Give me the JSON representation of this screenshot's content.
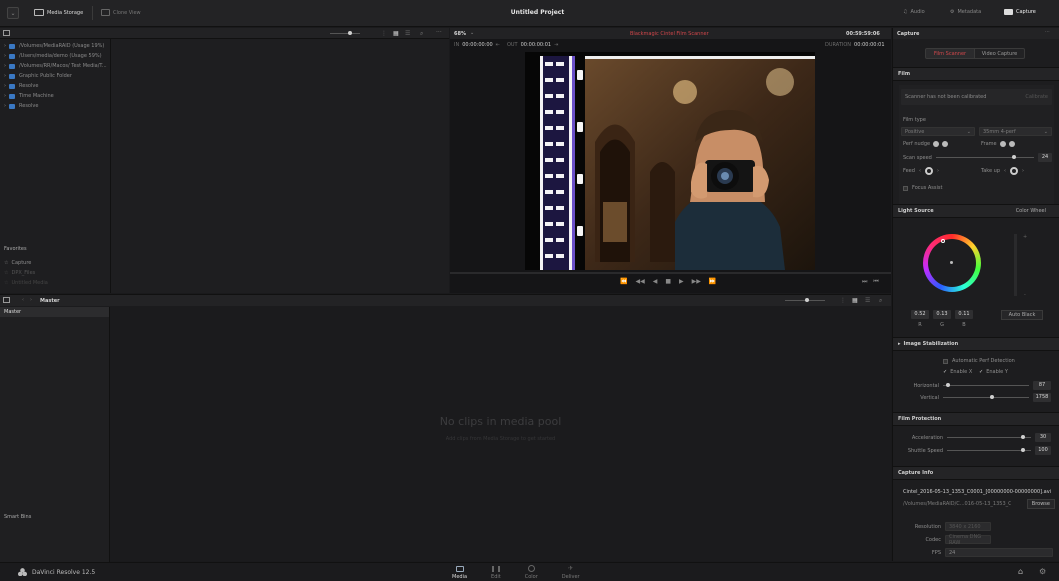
{
  "topbar": {
    "media_storage": "Media Storage",
    "clone_view": "Clone View",
    "project_title": "Untitled Project",
    "audio": "Audio",
    "metadata": "Metadata",
    "capture": "Capture"
  },
  "media_storage": {
    "locations": [
      "/Volumes/MediaRAID (Usage 19%)",
      "/Users/media/demo (Usage 59%)",
      "/Volumes/RR/Macos/ Test Media/T...",
      "Graphic Public Folder",
      "Resolve",
      "Time Machine",
      "Resolve"
    ],
    "favorites_header": "Favorites",
    "favorites": [
      "Capture",
      "DPX_Files",
      "Untitled Media"
    ]
  },
  "viewer": {
    "zoom": "68%",
    "timecode_label": "IN",
    "in_timecode": "00:00:00:00",
    "out_label": "OUT",
    "out_timecode": "00:00:00:01",
    "title": "Blackmagic Cintel Film Scanner",
    "timecode": "00:59:59:06",
    "duration_label": "DURATION",
    "duration": "00:00:00:01"
  },
  "media_pool": {
    "header": "Master",
    "bins": [
      "Master"
    ],
    "empty_title": "No clips in media pool",
    "empty_subtitle": "Add clips from Media Storage to get started",
    "smart_bins": "Smart Bins"
  },
  "capture_panel": {
    "title": "Capture",
    "tab_film": "Film Scanner",
    "tab_video": "Video Capture",
    "film_header": "Film",
    "calibration_status": "Scanner has not been calibrated",
    "calibrate_button": "Calibrate",
    "film_type_label": "Film type",
    "film_type_value": "Positive",
    "film_gauge_value": "35mm 4-perf",
    "perf_nudge_label": "Perf nudge",
    "frame_label": "Frame",
    "scan_speed_label": "Scan speed",
    "scan_speed_value": "24",
    "feed_label": "Feed",
    "take_up_label": "Take up",
    "focus_assist": "Focus Assist",
    "light_source_header": "Light Source",
    "color_wheel": "Color Wheel",
    "rgb_values": [
      "0.52",
      "0.13",
      "0.11"
    ],
    "rgb_labels": [
      "R",
      "G",
      "B"
    ],
    "auto_black": "Auto Black",
    "image_stab_header": "Image Stabilization",
    "auto_perf": "Automatic Perf Detection",
    "enable_x": "Enable X",
    "enable_y": "Enable Y",
    "horizontal_label": "Horizontal",
    "horizontal_value": "87",
    "vertical_label": "Vertical",
    "vertical_value": "1758",
    "film_protection_header": "Film Protection",
    "acceleration_label": "Acceleration",
    "acceleration_value": "30",
    "shuttle_speed_label": "Shuttle Speed",
    "shuttle_speed_value": "100",
    "capture_info_header": "Capture Info",
    "clip_name": "Cintel_2016-05-13_1353_C0001_[00000000-00000000].avi",
    "clip_path": "/Volumes/MediaRAID/C...016-05-13_1353_C0001",
    "browse_button": "Browse",
    "resolution_label": "Resolution",
    "resolution_value": "3840 x 2160",
    "codec_label": "Codec",
    "codec_value": "Cinema DNG RAW",
    "fps_label": "FPS",
    "fps_value": "24"
  },
  "bottom_bar": {
    "app_name": "DaVinci Resolve 12.5",
    "pages": [
      "Media",
      "Edit",
      "Color",
      "Deliver"
    ]
  },
  "colors": {
    "accent_red": "#d2474b",
    "background": "#1a1a1c",
    "panel": "#202022"
  }
}
